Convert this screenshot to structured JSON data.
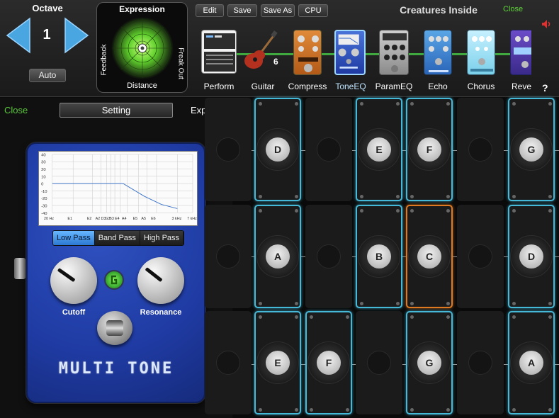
{
  "octave": {
    "title": "Octave",
    "value": "1",
    "auto_label": "Auto"
  },
  "expression": {
    "title": "Expression",
    "left_label": "Feedback",
    "right_label": "Freak Out",
    "bottom_label": "Distance"
  },
  "toolbar": {
    "edit": "Edit",
    "save": "Save",
    "save_as": "Save As",
    "cpu": "CPU"
  },
  "rig_name": "Creatures Inside",
  "close_top": "Close",
  "help": "?",
  "chain": [
    {
      "label": "Perform",
      "badge": ""
    },
    {
      "label": "Guitar",
      "badge": "6"
    },
    {
      "label": "Compress",
      "badge": ""
    },
    {
      "label": "ToneEQ",
      "badge": ""
    },
    {
      "label": "ParamEQ",
      "badge": ""
    },
    {
      "label": "Echo",
      "badge": ""
    },
    {
      "label": "Chorus",
      "badge": ""
    },
    {
      "label": "Reve",
      "badge": ""
    }
  ],
  "panel": {
    "close": "Close",
    "setting": "Setting",
    "expert": "Expert >"
  },
  "pedal": {
    "brand": "MULTI TONE",
    "filters": [
      "Low Pass",
      "Band Pass",
      "High Pass"
    ],
    "selected_filter": "Low Pass",
    "knob_cutoff": "Cutoff",
    "knob_resonance": "Resonance",
    "graph": {
      "y_ticks": [
        "40",
        "30",
        "20",
        "10",
        "0",
        "-10",
        "-20",
        "-30",
        "-40"
      ],
      "x_ticks": [
        "20 Hz",
        "E1",
        "E2",
        "A2",
        "D3",
        "G3",
        "B3",
        "E4",
        "A4",
        "E5",
        "A5",
        "E6",
        "3 kHz",
        "7 kHz"
      ]
    }
  },
  "pads": {
    "rows": [
      [
        "",
        "D",
        "",
        "E",
        "F",
        "",
        "G"
      ],
      [
        "",
        "A",
        "",
        "B",
        "C",
        "",
        "D"
      ],
      [
        "",
        "E",
        "F",
        "",
        "G",
        "",
        "A"
      ]
    ]
  },
  "colors": {
    "accent_green": "#5ed43a",
    "pad_active": "#47b9d8",
    "pad_hot": "#e07a22",
    "pedal_blue": "#1f3ba3"
  }
}
